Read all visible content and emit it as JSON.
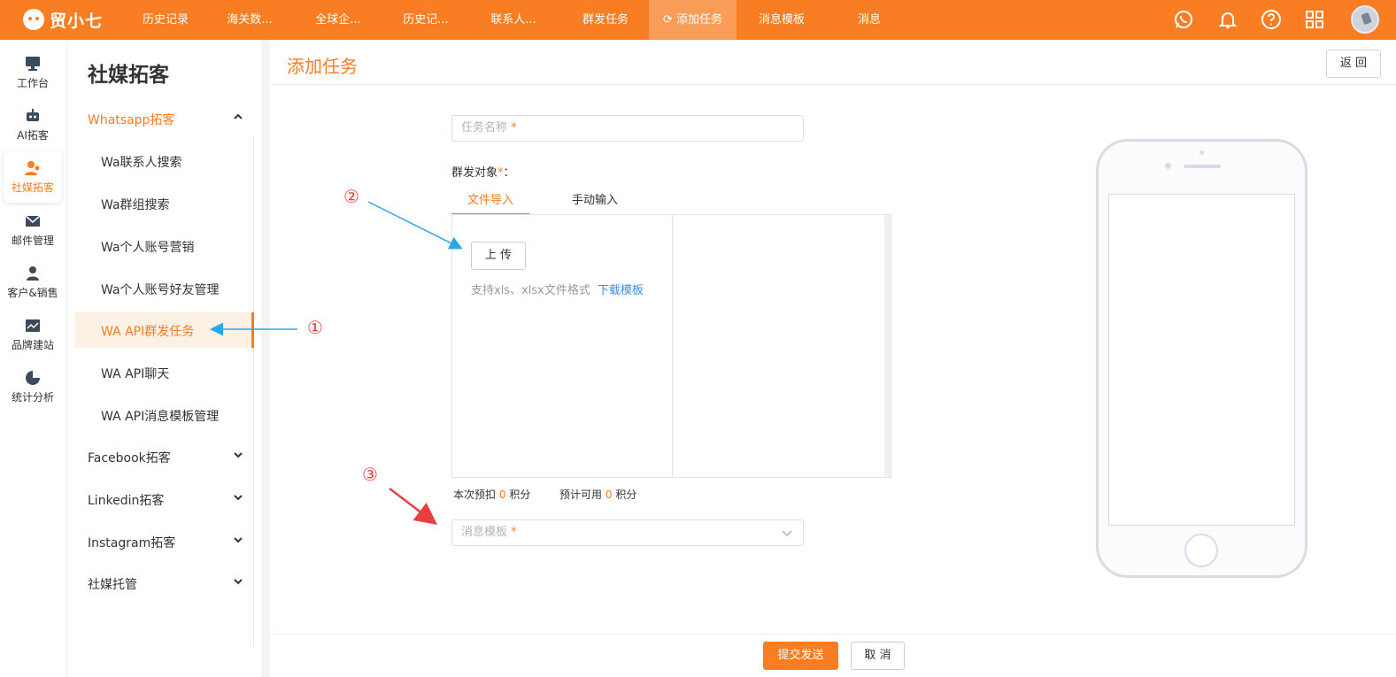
{
  "app": {
    "logo_text": "贸小七"
  },
  "topnav": {
    "items": [
      {
        "label": "历史记录"
      },
      {
        "label": "海关数..."
      },
      {
        "label": "全球企..."
      },
      {
        "label": "历史记..."
      },
      {
        "label": "联系人..."
      },
      {
        "label": "群发任务"
      },
      {
        "label": "添加任务",
        "active": true
      },
      {
        "label": "消息模板"
      },
      {
        "label": "消息"
      }
    ],
    "icons": [
      "whatsapp-icon",
      "bell-icon",
      "help-icon",
      "grid-icon"
    ]
  },
  "rail": {
    "items": [
      {
        "label": "工作台",
        "icon": "monitor-icon"
      },
      {
        "label": "AI拓客",
        "icon": "robot-icon"
      },
      {
        "label": "社媒拓客",
        "icon": "users-icon",
        "active": true
      },
      {
        "label": "邮件管理",
        "icon": "mail-icon"
      },
      {
        "label": "客户&销售",
        "icon": "person-icon"
      },
      {
        "label": "品牌建站",
        "icon": "chart-icon"
      },
      {
        "label": "统计分析",
        "icon": "pie-icon"
      }
    ]
  },
  "sidebar": {
    "title": "社媒拓客",
    "groups": [
      {
        "label": "Whatsapp拓客",
        "open": true
      },
      {
        "label": "Facebook拓客"
      },
      {
        "label": "Linkedin拓客"
      },
      {
        "label": "Instagram拓客"
      },
      {
        "label": "社媒托管"
      }
    ],
    "whatsapp_items": [
      {
        "label": "Wa联系人搜索"
      },
      {
        "label": "Wa群组搜索"
      },
      {
        "label": "Wa个人账号营销"
      },
      {
        "label": "Wa个人账号好友管理"
      },
      {
        "label": "WA API群发任务",
        "active": true
      },
      {
        "label": "WA API聊天"
      },
      {
        "label": "WA API消息模板管理"
      }
    ]
  },
  "main": {
    "title": "添加任务",
    "back_label": "返 回",
    "task_name_placeholder": "任务名称",
    "required_mark": "*",
    "target_label": "群发对象",
    "target_colon": "：",
    "tabs": [
      {
        "label": "文件导入",
        "active": true
      },
      {
        "label": "手动输入"
      }
    ],
    "upload_label": "上 传",
    "upload_hint": "支持xls、xlsx文件格式",
    "download_template": "下载模板",
    "points": {
      "deduct_prefix": "本次预扣",
      "deduct_value": "0",
      "deduct_suffix": "积分",
      "available_prefix": "预计可用",
      "available_value": "0",
      "available_suffix": "积分"
    },
    "template_placeholder": "消息模板",
    "submit_label": "提交发送",
    "cancel_label": "取 消"
  },
  "annotations": {
    "one": "①",
    "two": "②",
    "three": "③"
  },
  "colors": {
    "brand": "#f97d22",
    "arrow_blue": "#29a8e6",
    "arrow_red": "#e84040",
    "link": "#3a8ee6"
  }
}
